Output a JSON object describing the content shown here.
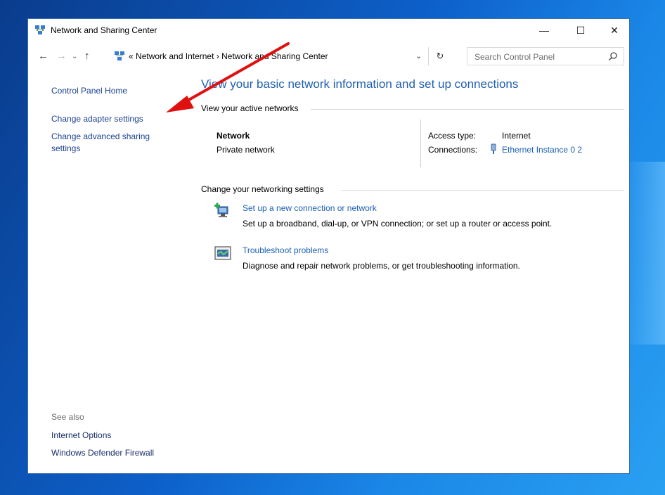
{
  "window": {
    "title": "Network and Sharing Center",
    "controls": {
      "minimize": "—",
      "maximize": "☐",
      "close": "✕"
    }
  },
  "address": {
    "prefix": "«",
    "crumb1": "Network and Internet",
    "separator": "›",
    "crumb2": "Network and Sharing Center",
    "search_placeholder": "Search Control Panel"
  },
  "sidebar": {
    "home": "Control Panel Home",
    "items": [
      {
        "label": "Change adapter settings"
      },
      {
        "label": "Change advanced sharing"
      },
      {
        "label": "settings"
      }
    ],
    "see_also": "See also",
    "see_also_links": [
      {
        "label": "Internet Options"
      },
      {
        "label": "Windows Defender Firewall"
      }
    ]
  },
  "main": {
    "title": "View your basic network information and set up connections",
    "active_networks_heading": "View your active networks",
    "network": {
      "name": "Network",
      "category": "Private network",
      "access_type_label": "Access type:",
      "access_type_value": "Internet",
      "connections_label": "Connections:",
      "connections_value": "Ethernet Instance 0 2"
    },
    "change_heading": "Change your networking settings",
    "tasks": [
      {
        "icon": "new-connection-icon",
        "link": "Set up a new connection or network",
        "description": "Set up a broadband, dial-up, or VPN connection; or set up a router or access point."
      },
      {
        "icon": "troubleshoot-icon",
        "link": "Troubleshoot problems",
        "description": "Diagnose and repair network problems, or get troubleshooting information."
      }
    ]
  },
  "colors": {
    "link": "#1a5fb4",
    "title": "#1f5fb0",
    "annotation_arrow": "#e01010",
    "desktop": "#0d5fc8"
  }
}
